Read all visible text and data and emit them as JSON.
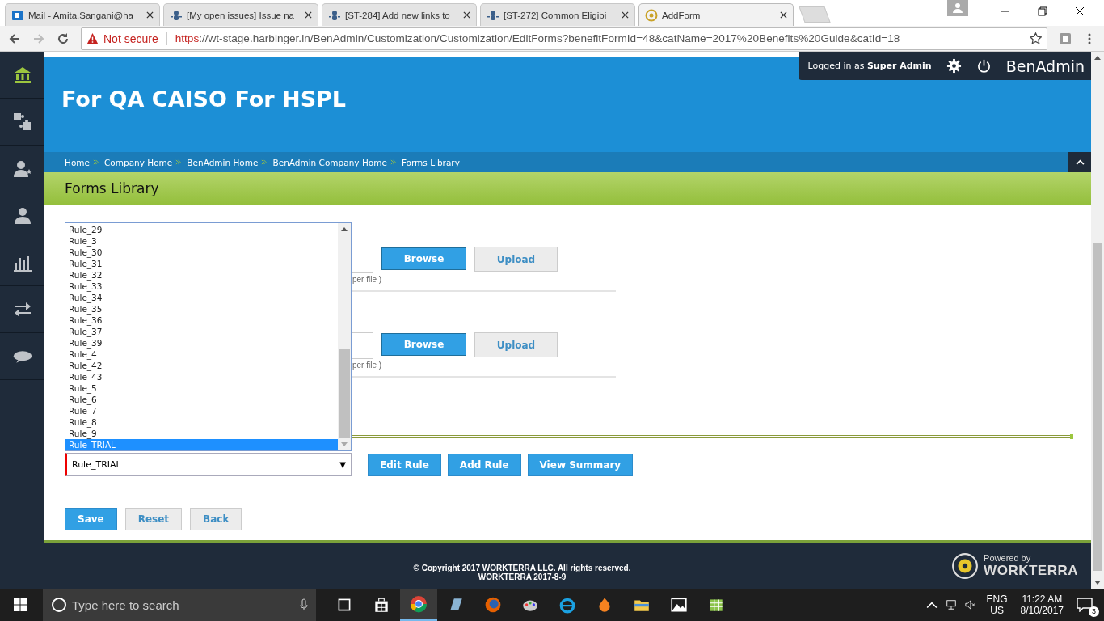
{
  "browser": {
    "tabs": [
      {
        "title": "Mail - Amita.Sangani@ha",
        "kind": "mail",
        "selected": false
      },
      {
        "title": "[My open issues] Issue na",
        "kind": "tracker",
        "selected": false
      },
      {
        "title": "[ST-284] Add new links to",
        "kind": "tracker",
        "selected": false
      },
      {
        "title": "[ST-272] Common Eligibi",
        "kind": "tracker",
        "selected": false
      },
      {
        "title": "AddForm",
        "kind": "site",
        "selected": true
      }
    ],
    "security": "Not secure",
    "url_scheme": "https",
    "url_rest": "://wt-stage.harbinger.in/BenAdmin/Customization/Customization/EditForms?benefitFormId=48&catName=2017%20Benefits%20Guide&catId=18"
  },
  "sidebar": {
    "items": [
      {
        "kind": "home",
        "selected": true
      },
      {
        "kind": "puzzle",
        "selected": false
      },
      {
        "kind": "user-star",
        "selected": false
      },
      {
        "kind": "user",
        "selected": false
      },
      {
        "kind": "chart",
        "selected": false
      },
      {
        "kind": "arrows",
        "selected": false
      },
      {
        "kind": "chat",
        "selected": false
      }
    ]
  },
  "header": {
    "title": "For QA CAISO For HSPL",
    "login_prefix": "Logged in as",
    "user": "Super Admin",
    "brand": "BenAdmin"
  },
  "breadcrumb": [
    "Home",
    "Company Home",
    "BenAdmin Home",
    "BenAdmin Company Home",
    "Forms Library"
  ],
  "page_title": "Forms Library",
  "upload_rows": [
    {
      "browse": "Browse",
      "upload": "Upload",
      "hint": "per file )"
    },
    {
      "browse": "Browse",
      "upload": "Upload",
      "hint": "per file )"
    }
  ],
  "rule_list": {
    "options": [
      {
        "label": "Rule_29",
        "selected": false
      },
      {
        "label": "Rule_3",
        "selected": false
      },
      {
        "label": "Rule_30",
        "selected": false
      },
      {
        "label": "Rule_31",
        "selected": false
      },
      {
        "label": "Rule_32",
        "selected": false
      },
      {
        "label": "Rule_33",
        "selected": false
      },
      {
        "label": "Rule_34",
        "selected": false
      },
      {
        "label": "Rule_35",
        "selected": false
      },
      {
        "label": "Rule_36",
        "selected": false
      },
      {
        "label": "Rule_37",
        "selected": false
      },
      {
        "label": "Rule_39",
        "selected": false
      },
      {
        "label": "Rule_4",
        "selected": false
      },
      {
        "label": "Rule_42",
        "selected": false
      },
      {
        "label": "Rule_43",
        "selected": false
      },
      {
        "label": "Rule_5",
        "selected": false
      },
      {
        "label": "Rule_6",
        "selected": false
      },
      {
        "label": "Rule_7",
        "selected": false
      },
      {
        "label": "Rule_8",
        "selected": false
      },
      {
        "label": "Rule_9",
        "selected": false
      },
      {
        "label": "Rule_TRIAL",
        "selected": true
      }
    ]
  },
  "rule_select": {
    "value": "Rule_TRIAL",
    "arrow": "▼"
  },
  "rule_buttons": [
    "Edit Rule",
    "Add Rule",
    "View Summary"
  ],
  "form_buttons": [
    {
      "label": "Save",
      "kind": "primary"
    },
    {
      "label": "Reset",
      "kind": "secondary"
    },
    {
      "label": "Back",
      "kind": "secondary"
    }
  ],
  "footer": {
    "copyright": "© Copyright 2017 WORKTERRA LLC. All rights reserved.",
    "version": "WORKTERRA 2017-8-9",
    "powered_by": "Powered by",
    "brand": "WORKTERRA"
  },
  "taskbar": {
    "search_placeholder": "Type here to search",
    "language": "ENG",
    "region": "US",
    "time": "11:22 AM",
    "date": "8/10/2017",
    "notifications": "3"
  }
}
